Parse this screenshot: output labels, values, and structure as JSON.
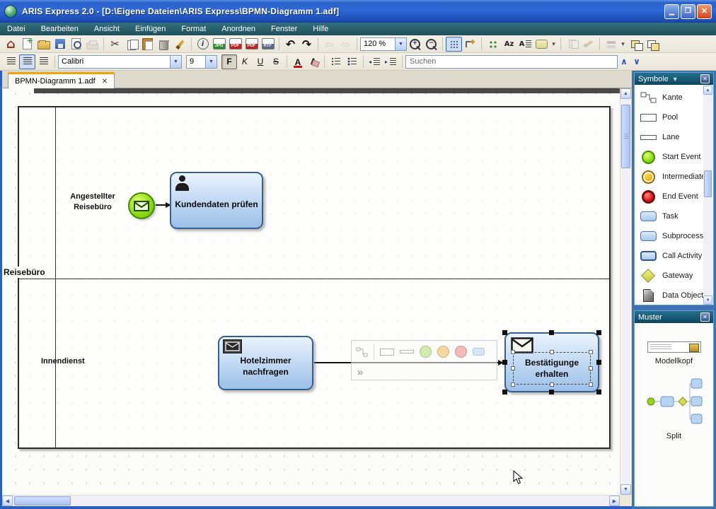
{
  "window": {
    "title": "ARIS Express 2.0 - [D:\\Eigene Dateien\\ARIS Express\\BPMN-Diagramm 1.adf]"
  },
  "menubar": {
    "items": [
      "Datei",
      "Bearbeiten",
      "Ansicht",
      "Einfügen",
      "Format",
      "Anordnen",
      "Fenster",
      "Hilfe"
    ]
  },
  "toolbar": {
    "zoom_value": "120 %",
    "badge_img": "JPG",
    "badge_pdf": "PDF",
    "badge_rtf": "RTF",
    "az_label": "Az",
    "icons": [
      "home-icon",
      "new-file-icon",
      "open-folder-icon",
      "save-icon",
      "print-preview-icon",
      "print-icon",
      "cut-icon",
      "copy-icon",
      "paste-icon",
      "delete-icon",
      "format-painter-icon",
      "info-icon",
      "export-image-icon",
      "export-pdf-icon",
      "export-pdf2-icon",
      "export-rtf-icon",
      "undo-icon",
      "redo-icon",
      "back-icon",
      "forward-icon",
      "zoom-in-icon",
      "zoom-out-icon",
      "grid-icon",
      "connector-icon",
      "distribute-icon",
      "font-sort-icon",
      "text-align-icon",
      "fill-color-icon",
      "group-icon",
      "edit-icon",
      "layer-icon",
      "bring-front-icon",
      "send-back-icon"
    ]
  },
  "formatbar": {
    "font_name": "Calibri",
    "font_size": "9",
    "bold_label": "F",
    "italic_label": "K",
    "underline_label": "U",
    "strike_label": "S",
    "font_color_label": "A",
    "clear_format_label": "A",
    "search_placeholder": "Suchen"
  },
  "tab": {
    "label": "BPMN-Diagramm 1.adf"
  },
  "canvas": {
    "pool_label": "Reisebüro",
    "lanes": [
      {
        "label": "Angestellter Reisebüro"
      },
      {
        "label": "Innendienst"
      }
    ],
    "tasks": [
      {
        "name": "Kundendaten prüfen"
      },
      {
        "name": "Hotelzimmer nachfragen"
      },
      {
        "name": "Bestätigunge erhalten"
      }
    ]
  },
  "symbols_panel": {
    "title": "Symbole",
    "items": [
      {
        "label": "Kante",
        "icon": "edge-icon"
      },
      {
        "label": "Pool",
        "icon": "pool-icon"
      },
      {
        "label": "Lane",
        "icon": "lane-icon"
      },
      {
        "label": "Start Event",
        "icon": "start-event-icon"
      },
      {
        "label": "Intermediate",
        "icon": "intermediate-event-icon"
      },
      {
        "label": "End Event",
        "icon": "end-event-icon"
      },
      {
        "label": "Task",
        "icon": "task-icon"
      },
      {
        "label": "Subprocess",
        "icon": "subprocess-icon"
      },
      {
        "label": "Call Activity",
        "icon": "call-activity-icon"
      },
      {
        "label": "Gateway",
        "icon": "gateway-icon"
      },
      {
        "label": "Data Object",
        "icon": "data-object-icon"
      }
    ]
  },
  "patterns_panel": {
    "title": "Muster",
    "items": [
      {
        "label": "Modellkopf"
      },
      {
        "label": "Split"
      }
    ]
  },
  "colors": {
    "accent_orange": "#f0a30a",
    "task_fill": "#c6dcf4",
    "task_border": "#36618f",
    "start_event_green": "#8ad810",
    "intermediate_orange": "#f2a800",
    "end_event_red": "#d40000",
    "gateway_yellow": "#c6ca38",
    "panel_title_teal": "#0e455c",
    "titlebar_blue": "#2a62c8"
  }
}
